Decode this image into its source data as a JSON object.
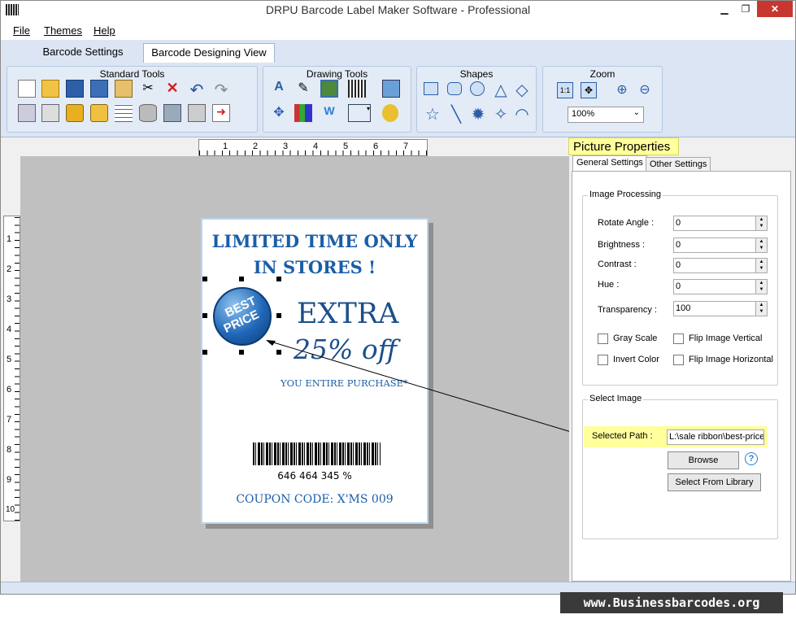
{
  "window": {
    "title": "DRPU Barcode Label Maker Software - Professional"
  },
  "menu": [
    "File",
    "Themes",
    "Help"
  ],
  "tabs": [
    "Barcode Settings",
    "Barcode Designing View"
  ],
  "ribbon": {
    "groups": [
      "Standard Tools",
      "Drawing Tools",
      "Shapes",
      "Zoom"
    ],
    "zoom_value": "100%"
  },
  "ruler": {
    "h_numbers": [
      "1",
      "2",
      "3",
      "4",
      "5",
      "6",
      "7"
    ],
    "v_numbers": [
      "1",
      "2",
      "3",
      "4",
      "5",
      "6",
      "7",
      "8",
      "9",
      "10"
    ]
  },
  "label": {
    "headline1": "LIMITED TIME ONLY",
    "headline2": "IN STORES !",
    "badge1": "BEST",
    "badge2": "PRICE",
    "extra": "EXTRA",
    "discount": "25% off",
    "purchase": "YOU ENTIRE PURCHASE*",
    "barcode_value": "646 464 345 %",
    "coupon": "COUPON CODE: X'MS 009"
  },
  "properties": {
    "title": "Picture Properties",
    "tabs": [
      "General Settings",
      "Other Settings"
    ],
    "image_processing": {
      "legend": "Image Processing",
      "fields": [
        {
          "label": "Rotate Angle :",
          "value": "0"
        },
        {
          "label": "Brightness    :",
          "value": "0"
        },
        {
          "label": "Contrast       :",
          "value": "0"
        },
        {
          "label": "Hue              :",
          "value": "0"
        },
        {
          "label": "Transparency :",
          "value": "100"
        }
      ],
      "checkboxes": [
        "Gray Scale",
        "Flip Image Vertical",
        "Invert Color",
        "Flip Image Horizontal"
      ]
    },
    "select_image": {
      "legend": "Select Image",
      "path_label": "Selected Path :",
      "path_value": "L:\\sale ribbon\\best-price",
      "browse": "Browse",
      "library": "Select From Library"
    }
  },
  "brand": "www.Businessbarcodes.org",
  "colors": {
    "accent": "#1a5ea8",
    "ribbon": "#dbe5f3",
    "tooltip": "#ffff9c"
  }
}
